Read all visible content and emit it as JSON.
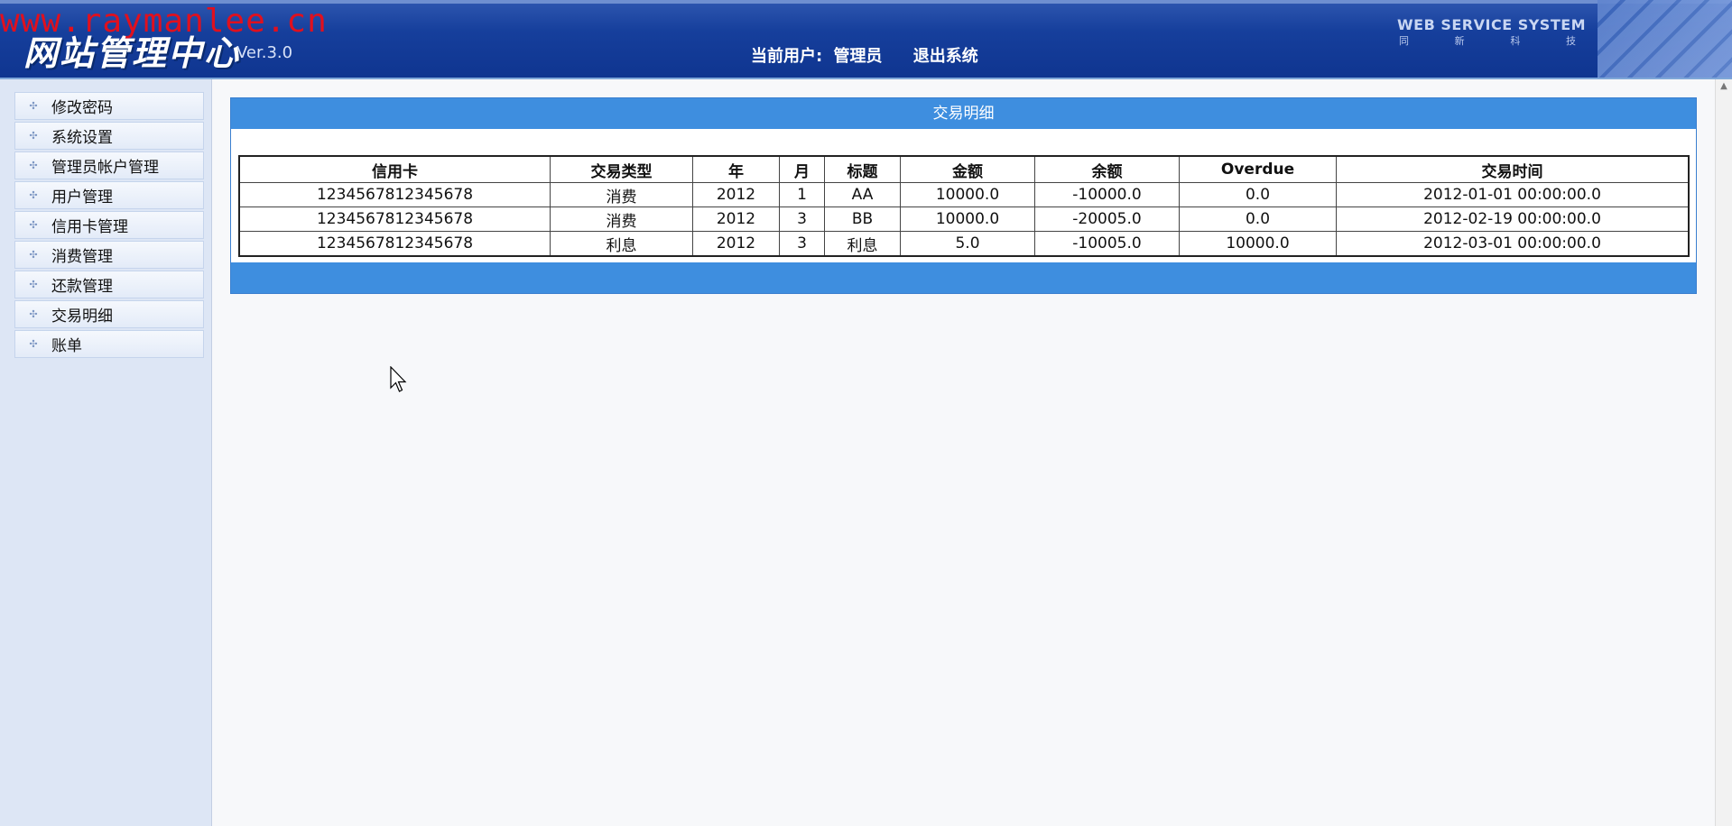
{
  "header": {
    "watermark": "www.raymanlee.cn",
    "logo_title": "网站管理中心",
    "version": "Ver.3.0",
    "current_user_label": "当前用户:",
    "current_user": "管理员",
    "logout": "退出系统",
    "system_name": "WEB SERVICE SYSTEM",
    "system_sub": [
      "同",
      "新",
      "科",
      "技"
    ]
  },
  "sidebar": {
    "items": [
      {
        "label": "修改密码"
      },
      {
        "label": "系统设置"
      },
      {
        "label": "管理员帐户管理"
      },
      {
        "label": "用户管理"
      },
      {
        "label": "信用卡管理"
      },
      {
        "label": "消费管理"
      },
      {
        "label": "还款管理"
      },
      {
        "label": "交易明细"
      },
      {
        "label": "账单"
      }
    ]
  },
  "panel": {
    "title": "交易明细",
    "columns": [
      "信用卡",
      "交易类型",
      "年",
      "月",
      "标题",
      "金额",
      "余额",
      "Overdue",
      "交易时间"
    ],
    "rows": [
      [
        "1234567812345678",
        "消费",
        "2012",
        "1",
        "AA",
        "10000.0",
        "-10000.0",
        "0.0",
        "2012-01-01 00:00:00.0"
      ],
      [
        "1234567812345678",
        "消费",
        "2012",
        "3",
        "BB",
        "10000.0",
        "-20005.0",
        "0.0",
        "2012-02-19 00:00:00.0"
      ],
      [
        "1234567812345678",
        "利息",
        "2012",
        "3",
        "利息",
        "5.0",
        "-10005.0",
        "10000.0",
        "2012-03-01 00:00:00.0"
      ]
    ]
  },
  "colors": {
    "header_blue": "#163f9c",
    "panel_blue": "#3e8edf",
    "sidebar_bg": "#dde6f5"
  }
}
